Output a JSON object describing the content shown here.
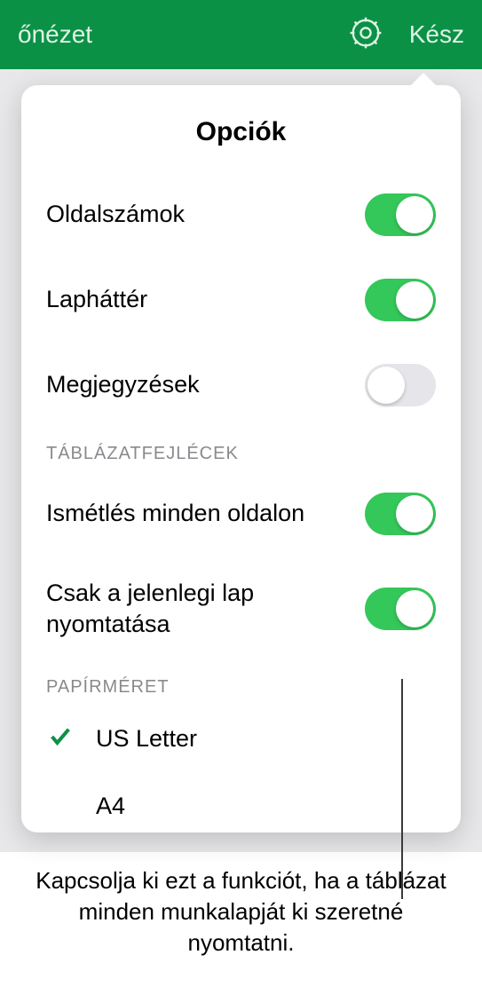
{
  "topbar": {
    "left": "őnézet",
    "done": "Kész"
  },
  "popover": {
    "title": "Opciók",
    "options": {
      "page_numbers": {
        "label": "Oldalszámok",
        "on": true
      },
      "background": {
        "label": "Lapháttér",
        "on": true
      },
      "comments": {
        "label": "Megjegyzések",
        "on": false
      }
    },
    "section_headers": {
      "table_headers": "TÁBLÁZATFEJLÉCEK",
      "paper_size": "PAPÍRMÉRET"
    },
    "repeat_headers": {
      "label": "Ismétlés minden oldalon",
      "on": true
    },
    "current_sheet_only": {
      "label": "Csak a jelenlegi lap nyomtatása",
      "on": true
    },
    "paper_sizes": {
      "us_letter": {
        "label": "US Letter",
        "selected": true
      },
      "a4": {
        "label": "A4",
        "selected": false
      }
    }
  },
  "callout": "Kapcsolja ki ezt a funkciót, ha a táblázat minden munkalapját ki szeretné nyomtatni."
}
